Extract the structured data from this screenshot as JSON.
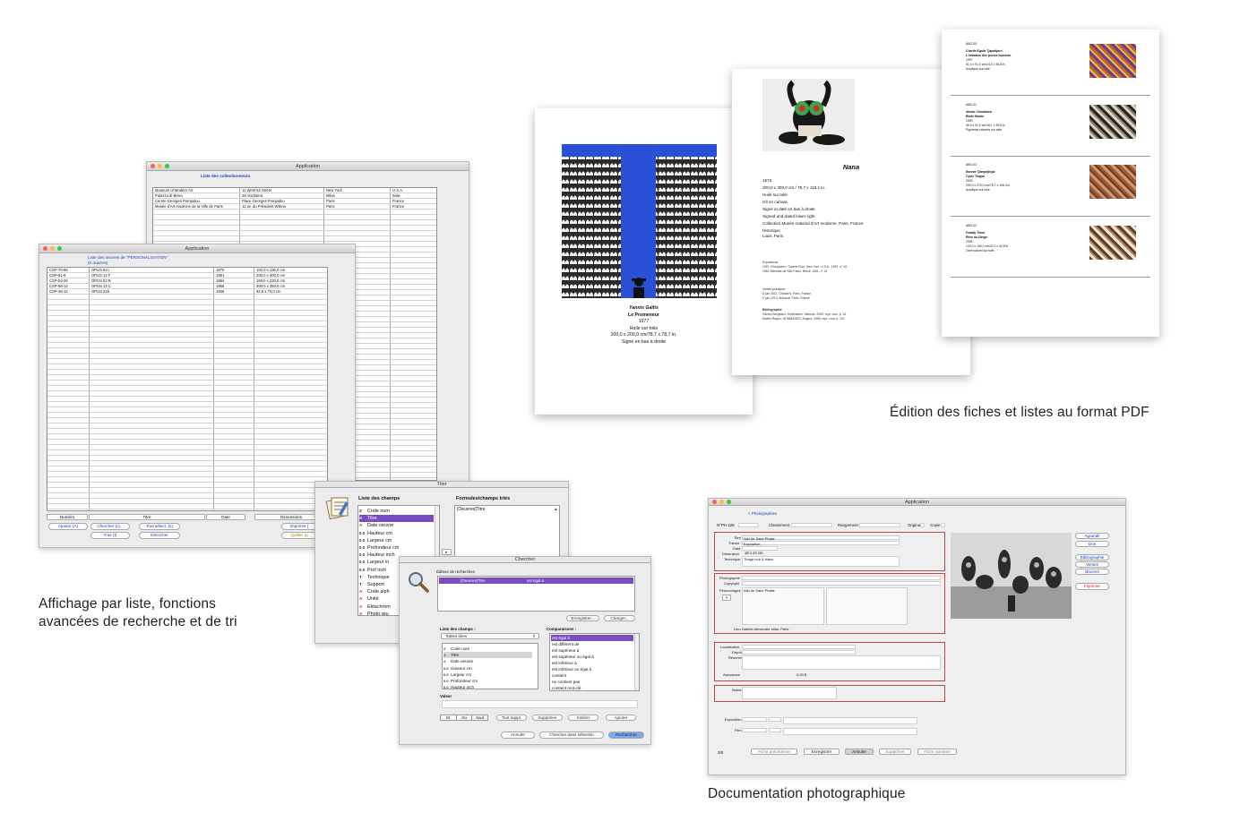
{
  "captions": {
    "pdf": "Édition des fiches et listes au format PDF",
    "list_line1": "Affichage par liste, fonctions",
    "list_line2": "avancées de recherche et de tri",
    "photo": "Documentation photographique"
  },
  "collectors_window": {
    "title": "Application",
    "heading": "Liste des collectionneurs",
    "rows": [
      [
        "Museum of Modern Art",
        "11 West 53 Street",
        "New York",
        "U.S.A."
      ],
      [
        "Palazzo di Brera",
        "28 Via Brera",
        "Milan",
        "Italie"
      ],
      [
        "Centre Georges Pompidou",
        "Place Georges Pompidou",
        "Paris",
        "France"
      ],
      [
        "Musée d'Art moderne de la Ville de Paris",
        "11 av. du Président Wilson",
        "Paris",
        "France"
      ]
    ]
  },
  "works_window": {
    "title": "Application",
    "heading": "Liste des œuvres de \"PERSONALISATION\"",
    "count": "(5 œuvres)",
    "rows": [
      [
        "CSP-70-65",
        "OPUS 53 I",
        "1970",
        "102,0 x 130,0 cm"
      ],
      [
        "CSP-61-8",
        "OPUS 12 F",
        "1961",
        "200,0 x 300,0 cm"
      ],
      [
        "CSP-54-25",
        "OPUS 63 B",
        "1954",
        "150,0 x 220,0 cm"
      ],
      [
        "CSP-56-12",
        "OPUS 13 C",
        "1956",
        "200,0 x 350,0 cm"
      ],
      [
        "CSP-46-12",
        "OPUS 21b",
        "1946",
        "92,0 x 73,0 cm"
      ]
    ],
    "columns": [
      "Numéro",
      "Titre",
      "Date",
      "Dimensions"
    ],
    "buttons": {
      "add": "Ajouter (A)",
      "search": "Chercher (c)...",
      "select_all": "Tout sélect. (s)",
      "print": "Imprimer (",
      "sort": "Trier (t)",
      "deselect": "Décocher",
      "quit": "Quitter (q"
    }
  },
  "sort_window": {
    "title": "Trier",
    "fields_label": "Liste des champs",
    "sorted_label": "Formules/champs triés",
    "fields": [
      {
        "type": "Z",
        "name": "Code num"
      },
      {
        "type": "A",
        "name": "Titre"
      },
      {
        "type": "A",
        "name": "Date oeuvre"
      },
      {
        "type": "0.0",
        "name": "Hauteur cm"
      },
      {
        "type": "0.0",
        "name": "Largeur cm"
      },
      {
        "type": "0.0",
        "name": "Profondeur cm"
      },
      {
        "type": "0.0",
        "name": "Hauteur inch"
      },
      {
        "type": "0.0",
        "name": "Largeur in"
      },
      {
        "type": "0.0",
        "name": "Prof inch"
      },
      {
        "type": "T",
        "name": "Technique"
      },
      {
        "type": "T",
        "name": "Support"
      },
      {
        "type": "A",
        "name": "Code alph"
      },
      {
        "type": "A",
        "name": "Unité"
      },
      {
        "type": "A",
        "name": "Ektachrom"
      },
      {
        "type": "A",
        "name": "Photo œu"
      }
    ],
    "sorted": "[Oeuvres]Titre"
  },
  "search_window": {
    "title": "Chercher",
    "editor_label": "Éditeur de recherches",
    "criterion_field": "[Oeuvres]Titre",
    "criterion_op": "est égal à",
    "save": "Enregistrer...",
    "load": "Charger...",
    "fields_label": "Liste des champs :",
    "tables_label": "Tables liées",
    "fields": [
      {
        "type": "Z",
        "name": "Code num"
      },
      {
        "type": "A",
        "name": "Titre"
      },
      {
        "type": "A",
        "name": "Date oeuvre"
      },
      {
        "type": "0.0",
        "name": "Hauteur cm"
      },
      {
        "type": "0.0",
        "name": "Largeur cm"
      },
      {
        "type": "0.0",
        "name": "Profondeur cm"
      },
      {
        "type": "0.0",
        "name": "Hauteur inch"
      },
      {
        "type": "0.0",
        "name": "Largeur inch"
      }
    ],
    "comparisons_label": "Comparaisons :",
    "comparisons": [
      "est égal à",
      "est différent de",
      "est supérieur à",
      "est supérieur ou égal à",
      "est inférieur à",
      "est inférieur ou égal à",
      "contient",
      "ne contient pas",
      "contient mot-clé"
    ],
    "value_label": "Valeur",
    "logic": [
      "Et",
      "Ou",
      "Sauf"
    ],
    "delete_all": "Tout suppr.",
    "delete": "Supprimer",
    "insert": "Insérer",
    "add": "Ajouter",
    "cancel": "Annuler",
    "search_in_selection": "Chercher dans sélection",
    "search": "Rechercher"
  },
  "pdf1": {
    "artist": "Yannis Gaïtis",
    "title": "Le Promeneur",
    "year": "1977",
    "medium": "Huile sur toile",
    "dims": "200,0 x 200,0 cm/78,7 x 78,7 in.",
    "signed": "Signé en bas à droite"
  },
  "pdf2": {
    "title": "Nana",
    "lines": [
      "1973",
      "200,0 x 300,0 cm / 78,7 x 118,1 in.",
      "Huile sur toile",
      "Oil on canvas",
      "Signé et daté en bas à droite",
      "Signed and dated lower right",
      "Collection Musée national d'Art moderne, Paris, France"
    ],
    "hist_label": "Historique",
    "hist": "Louis, Paris",
    "expo_label": "Expositions",
    "expo": [
      "1957 «Sculpture», Galerie Ruiz, New York, U.S.A., 1957, n° 40",
      "1961 Biennale de São Paulo, Brésil, 1961, n° 21"
    ],
    "sales_label": "Ventes publiques",
    "sales": [
      "8 juin 2011, Christie's, Paris, France",
      "2 juin 2013, Artcurial, Paris, France"
    ],
    "biblio_label": "Bibliographie",
    "biblio": [
      "Gérard Bergeaux, Hollenstein, Valence, 2005, repr. coul. p. 16",
      "Michel Ragon, HOMMAGES, Angers, 1998, repr. coul. p. 121"
    ]
  },
  "pdf3": {
    "items": [
      {
        "code": "ABO-05",
        "artist": "Charlie Egalie Tjapaltjarri",
        "title": "L'initiation des jeunes hommes",
        "year": "1997",
        "dims": "61,0 x 91,0 cm/24,0 x 35,8 in.",
        "medium": "Acrylique sur toile"
      },
      {
        "code": "ABO-02",
        "artist": "Nectar Chandaloo",
        "title": "Étoile filante",
        "year": "1990",
        "dims": "46,0 x 91,0 cm/18,1 x 35,8 in.",
        "medium": "Pigments naturels sur toile"
      },
      {
        "code": "ABO-03",
        "artist": "Ronnie Tjampitjinpa",
        "title": "Cycle Tingari",
        "year": "2003",
        "dims": "200,0 x 270,0 cm/78,7 x 106,3 in.",
        "medium": "Acrylique sur toile"
      },
      {
        "code": "ABO-02",
        "artist": "Freddy Timm",
        "title": "Rêve du Dingo",
        "year": "1995",
        "dims": "120,0 x 100,0 cm/47,2 x 42,8 in.",
        "medium": "Ocre naturel sur toile"
      }
    ]
  },
  "photo_window": {
    "title": "Application",
    "breadcrumb": "< Photographies",
    "num_label": "N°PH",
    "num": "128",
    "classement": "Classement",
    "rangement": "Rangement",
    "original": "Original",
    "copie": "Copie",
    "titre_label": "Titre",
    "titre": "Niki de Saint Phalle",
    "theme_label": "Thème",
    "theme": "Exposition",
    "date_label": "Date",
    "dim_label": "Dimension",
    "dim_w": "18",
    "dim_x": "x",
    "dim_h": "24",
    "dim_unit": "cm",
    "tech_label": "Technique",
    "tech": "Tirage noir & blanc",
    "photographe_label": "Photographe",
    "copyright_label": "Copyright",
    "personnages_label": "Personnages",
    "personnages": "Niki de Saint Phalle",
    "lieu_label": "Lieu",
    "lieu": "Galerie Alexandre Iolas, Paris",
    "localisation_label": "Localisation",
    "depot_label": "Dépôt",
    "reserve_label": "Réservé",
    "assurance_label": "Assurance",
    "assurance": "0,00 $",
    "notes_label": "Notes",
    "exposition_label": "Exposition",
    "film_label": "Film",
    "side_buttons": [
      "Agrandir",
      "Dos",
      "Bibliographie",
      "Ventes",
      "Œuvres"
    ],
    "print": "Imprimer",
    "record": "3/8",
    "bottom": [
      "Fiche précédente",
      "Enregistrer",
      "Annuler",
      "Supprimer",
      "Fiche suivante"
    ]
  },
  "colors": {
    "accent_blue": "#1d3fc0",
    "selection": "#7b4bc4",
    "highlight_red": "#b74a4a",
    "pdf_blue": "#2a50d8"
  }
}
